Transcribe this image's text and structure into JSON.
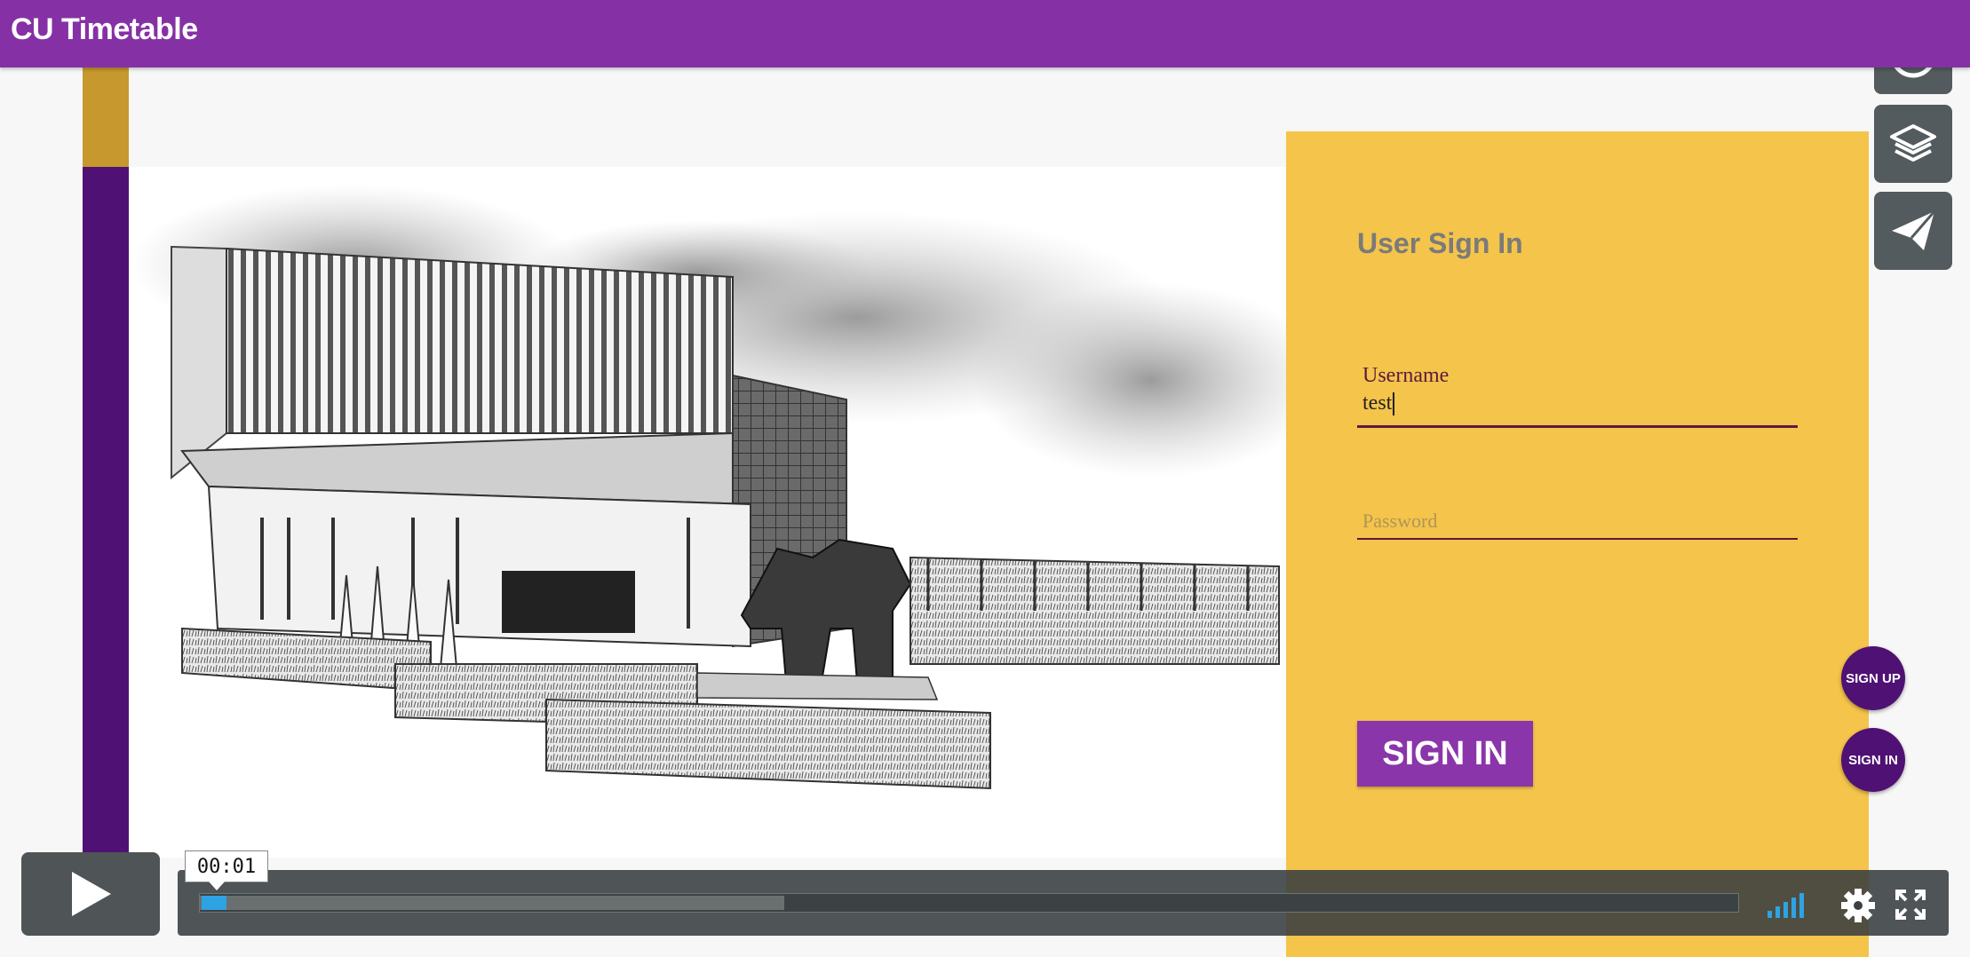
{
  "app": {
    "title": "CU Timetable"
  },
  "signin": {
    "title": "User Sign In",
    "username_label": "Username",
    "username_value": "test",
    "password_placeholder": "Password",
    "button_label": "SIGN IN"
  },
  "side_buttons": {
    "signup": "SIGN UP",
    "signin": "SIGN IN"
  },
  "toolbar": {
    "icons": [
      "clock-icon",
      "layers-icon",
      "paper-plane-icon"
    ]
  },
  "video": {
    "time": "00:01",
    "progress": 0.013,
    "buffered": 0.38
  },
  "colors": {
    "brand_purple": "#8531a5",
    "dark_purple": "#4f1173",
    "gold": "#f4c44b",
    "accent_blue": "#2ea3e3"
  }
}
